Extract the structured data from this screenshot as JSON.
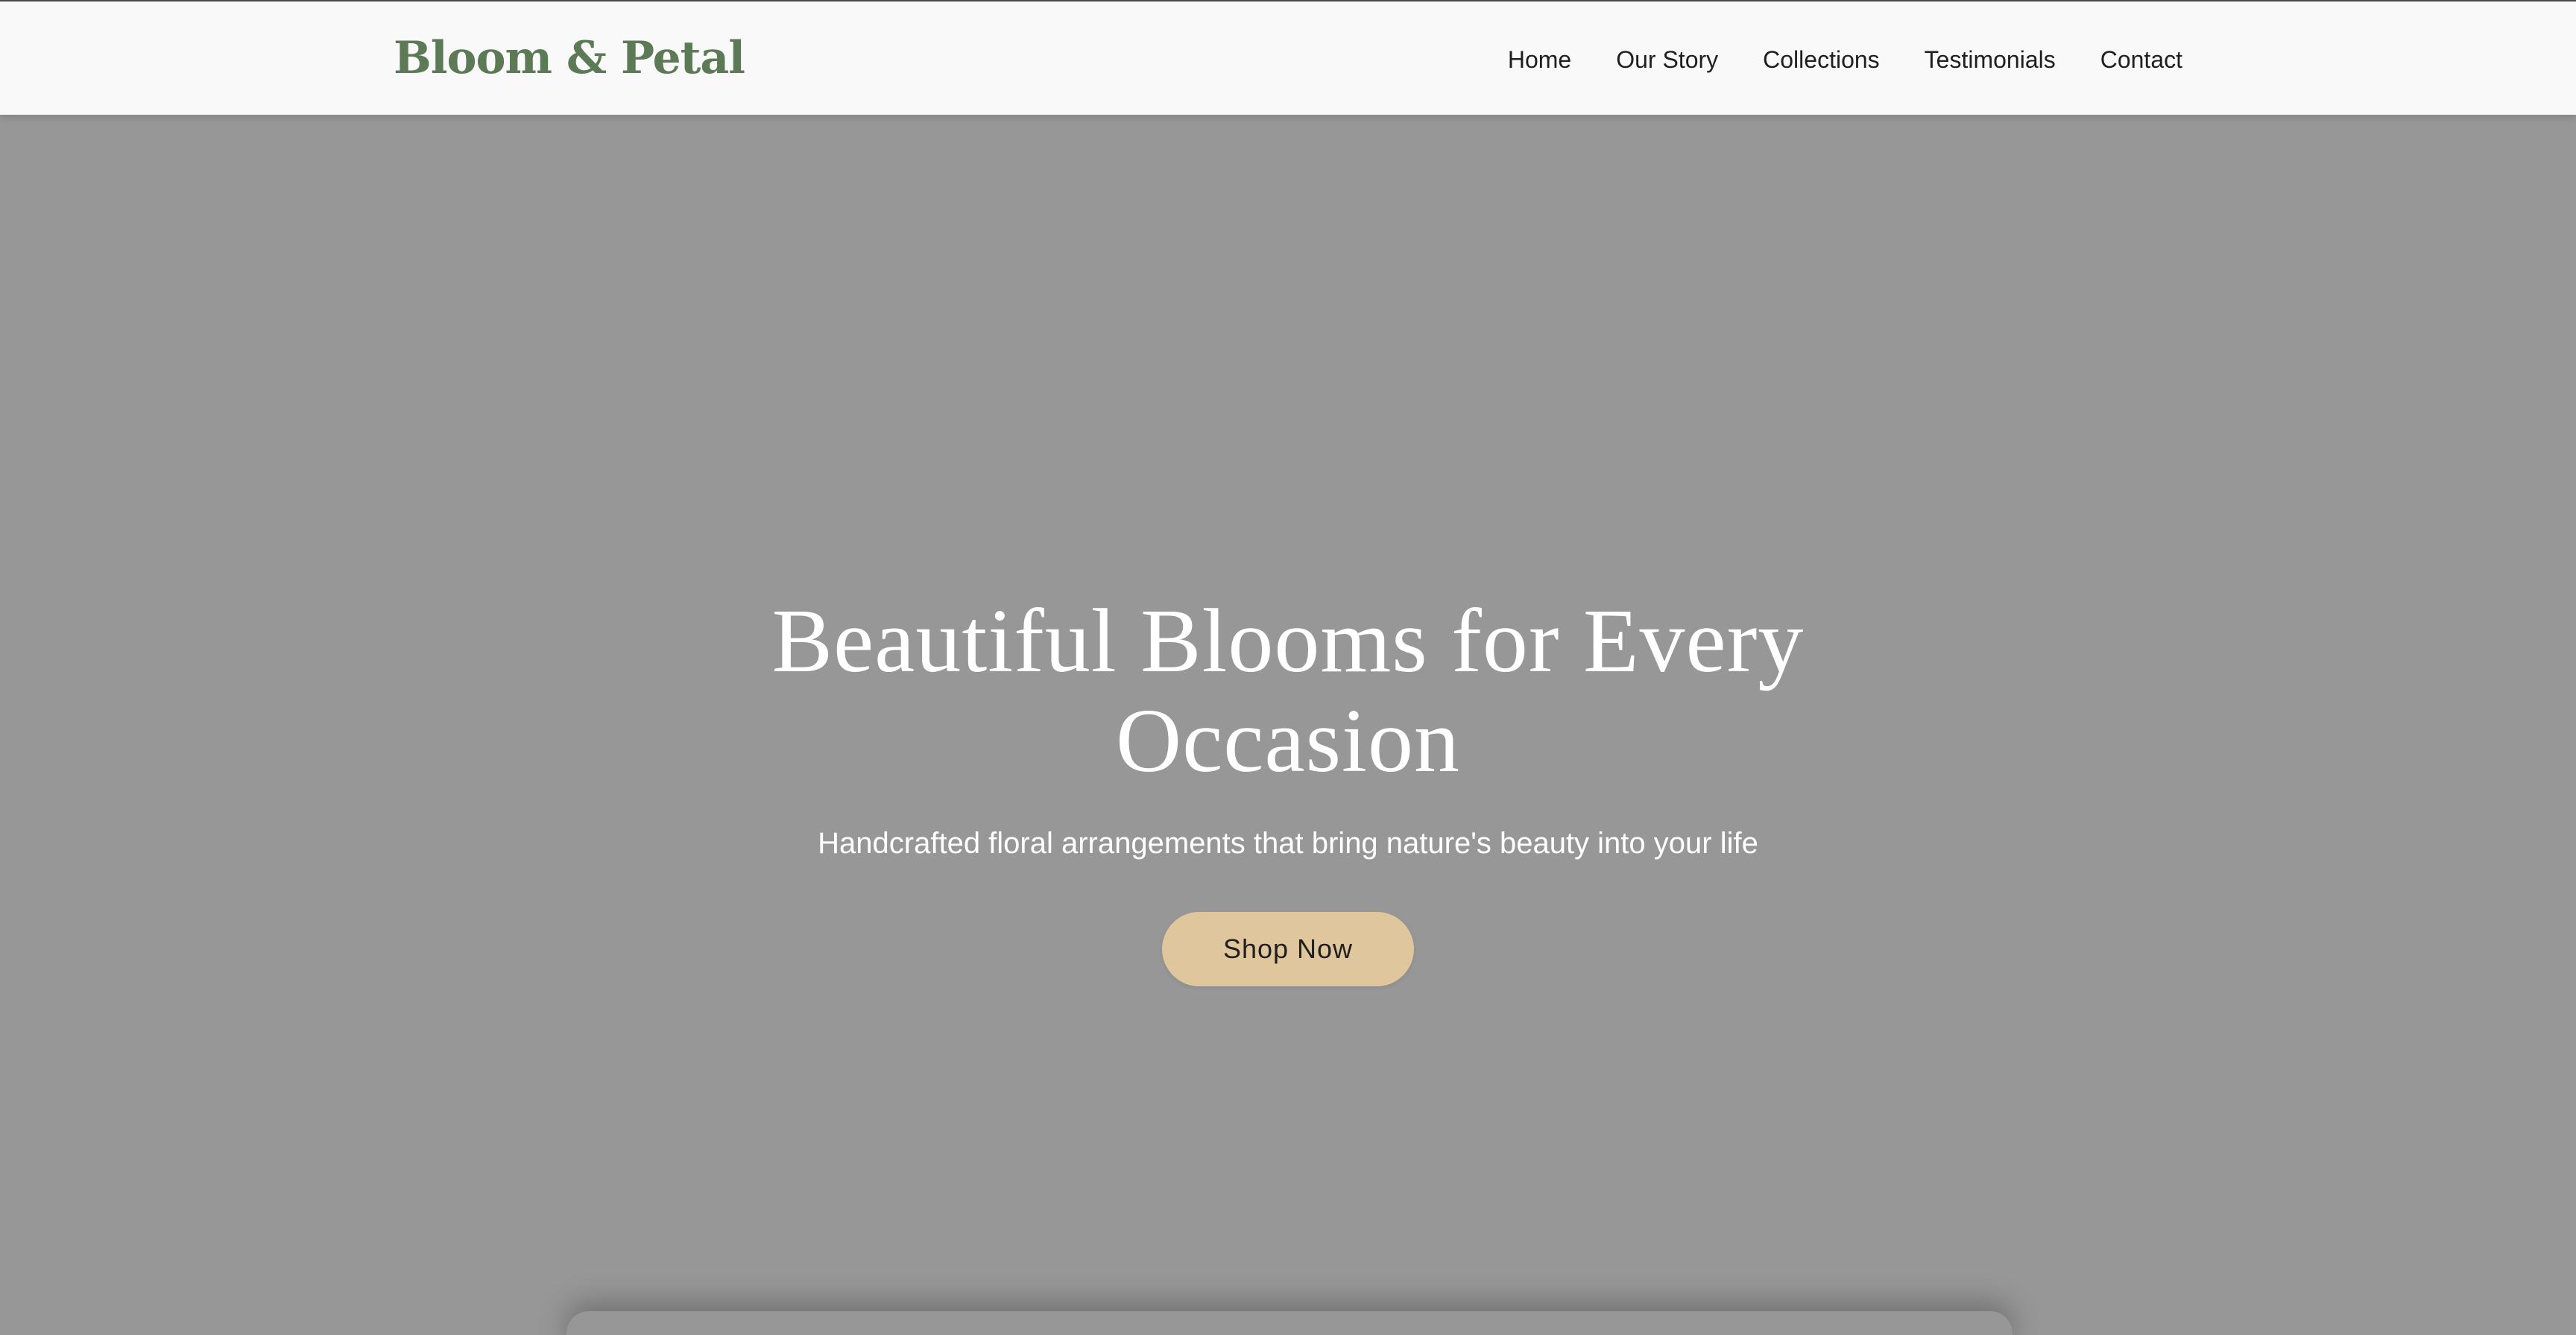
{
  "header": {
    "brand": "Bloom & Petal",
    "nav": [
      {
        "label": "Home"
      },
      {
        "label": "Our Story"
      },
      {
        "label": "Collections"
      },
      {
        "label": "Testimonials"
      },
      {
        "label": "Contact"
      }
    ]
  },
  "hero": {
    "title_line1": "Beautiful Blooms for Every",
    "title_line2": "Occasion",
    "subtitle": "Handcrafted floral arrangements that bring nature's beauty into your life",
    "cta_label": "Shop Now"
  },
  "colors": {
    "brand": "#5c7a56",
    "header_bg": "#f9f9f9",
    "hero_bg": "#979797",
    "cta_bg": "#dfc69c",
    "text_light": "#ffffff",
    "text_dark": "#1f1f1f"
  }
}
